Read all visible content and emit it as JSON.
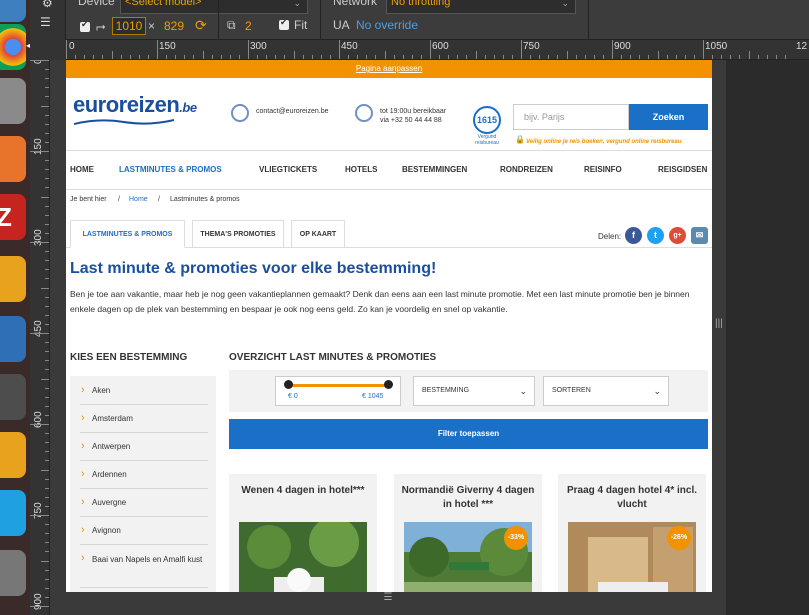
{
  "devtools": {
    "device_label": "Device",
    "device_value": "<Select model>",
    "network_label": "Network",
    "network_value": "No throttling",
    "width": "1010",
    "times": "×",
    "height": "829",
    "zoom": "2",
    "fit_label": "Fit",
    "ua_label": "UA",
    "ua_value": "No override"
  },
  "ruler": {
    "top": [
      "0",
      "150",
      "300",
      "450",
      "600",
      "750",
      "900",
      "1050",
      "12"
    ],
    "left": [
      "0",
      "150",
      "300",
      "450",
      "600",
      "750",
      "900"
    ]
  },
  "site": {
    "topbar_link": "Pagina aanpassen",
    "logo": "euroreizen",
    "logo_tld": ".be",
    "contact_email": "contact@euroreizen.be",
    "phone_line1": "tot 19:00u bereikbaar",
    "phone_line2": "via +32 50 44 44 88",
    "badge": "1615",
    "badge_sub": "Vergund reisbureau",
    "search_placeholder": "bijv. Parijs",
    "search_button": "Zoeken",
    "secure_text": "Veilig online je reis boeken, vergund online reisbureau",
    "nav": [
      "HOME",
      "LASTMINUTES & PROMOS",
      "VLIEGTICKETS",
      "HOTELS",
      "BESTEMMINGEN",
      "RONDREIZEN",
      "REISINFO",
      "REISGIDSEN"
    ],
    "breadcrumb": {
      "prefix": "Je bent hier",
      "sep": "/",
      "home": "Home",
      "current": "Lastminutes & promos"
    },
    "tabs": [
      "LASTMINUTES & PROMOS",
      "THEMA'S PROMOTIES",
      "OP KAART"
    ],
    "share_label": "Delen:",
    "headline": "Last minute & promoties voor elke bestemming!",
    "intro": "Ben je toe aan vakantie, maar heb je nog geen vakantieplannen gemaakt? Denk dan eens aan een last minute promotie. Met een last minute promotie ben je binnen enkele dagen op de plek van bestemming en bespaar je ook nog eens geld. Zo kan je voordelig en snel op vakantie.",
    "sidebar_title": "KIES EEN BESTEMMING",
    "destinations": [
      "Aken",
      "Amsterdam",
      "Antwerpen",
      "Ardennen",
      "Auvergne",
      "Avignon",
      "Baai van Napels en Amalfi kust"
    ],
    "main_title": "OVERZICHT LAST MINUTES & PROMOTIES",
    "price_min": "€ 0",
    "price_max": "€ 1045",
    "price_range_fraction": [
      0.0,
      1.0
    ],
    "dropdown_destination": "BESTEMMING",
    "dropdown_sort": "SORTEREN",
    "apply_button": "Filter toepassen",
    "cards": [
      {
        "title": "Wenen 4 dagen in hotel***",
        "discount": ""
      },
      {
        "title": "Normandië Giverny 4 dagen in hotel ***",
        "discount": "-33%"
      },
      {
        "title": "Praag 4 dagen hotel 4* incl. vlucht",
        "discount": "-26%"
      }
    ]
  },
  "colors": {
    "brand_blue": "#1a6fc6",
    "brand_orange": "#f39200",
    "devtools_accent": "#e8a000"
  }
}
